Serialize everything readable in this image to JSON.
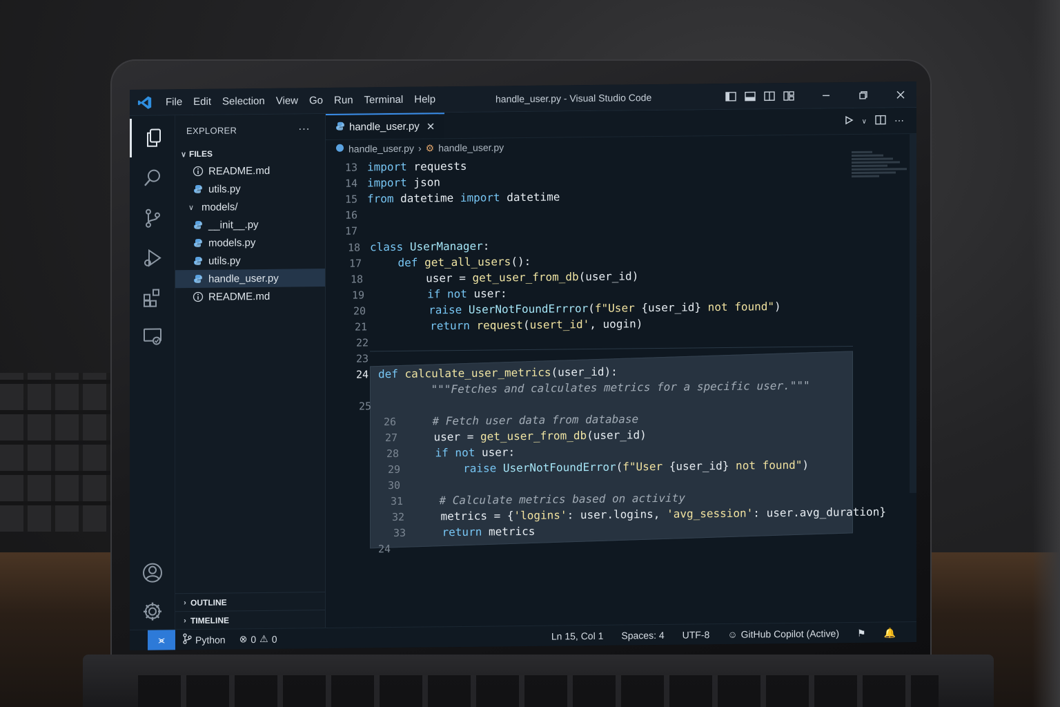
{
  "window": {
    "title": "handle_user.py - Visual Studio Code",
    "menu": [
      "File",
      "Edit",
      "Selection",
      "View",
      "Go",
      "Run",
      "Terminal",
      "Help"
    ]
  },
  "sidebar": {
    "header": "EXPLORER",
    "more": "···",
    "files_section": "FILES",
    "items": [
      {
        "label": "README.md",
        "icon": "info-icon",
        "indent": 1
      },
      {
        "label": "utils.py",
        "icon": "python-icon",
        "indent": 1
      },
      {
        "label": "models/",
        "icon": "folder-chevron",
        "indent": 0
      },
      {
        "label": "__init__.py",
        "icon": "python-icon",
        "indent": 1
      },
      {
        "label": "models.py",
        "icon": "python-icon",
        "indent": 1
      },
      {
        "label": "utils.py",
        "icon": "python-icon",
        "indent": 1
      },
      {
        "label": "handle_user.py",
        "icon": "python-icon",
        "indent": 1,
        "selected": true
      },
      {
        "label": "README.md",
        "icon": "info-icon",
        "indent": 1
      }
    ],
    "outline": "OUTLINE",
    "timeline": "TIMELINE"
  },
  "editor": {
    "tab": "handle_user.py",
    "breadcrumb": [
      "handle_user.py",
      "handle_user.py"
    ],
    "lines": [
      {
        "n": "13",
        "code": [
          [
            "kw",
            "import"
          ],
          [
            "var",
            " requests"
          ]
        ]
      },
      {
        "n": "14",
        "code": [
          [
            "kw",
            "import"
          ],
          [
            "var",
            " json"
          ]
        ]
      },
      {
        "n": "15",
        "code": [
          [
            "kw",
            "from"
          ],
          [
            "var",
            " datetime "
          ],
          [
            "kw",
            "import"
          ],
          [
            "var",
            " datetime"
          ]
        ]
      },
      {
        "n": "16",
        "code": []
      },
      {
        "n": "17",
        "code": []
      },
      {
        "n": "18",
        "code": [
          [
            "kw",
            "class"
          ],
          [
            "var",
            " "
          ],
          [
            "cls",
            "UserManager"
          ],
          [
            "var",
            ":"
          ]
        ]
      },
      {
        "n": "17",
        "code": [
          [
            "var",
            "    "
          ],
          [
            "kw",
            "def"
          ],
          [
            "var",
            " "
          ],
          [
            "fn",
            "get_all_users"
          ],
          [
            "var",
            "():"
          ]
        ]
      },
      {
        "n": "18",
        "code": [
          [
            "var",
            "        user = "
          ],
          [
            "fn",
            "get_user_from_db"
          ],
          [
            "var",
            "(user_id)"
          ]
        ]
      },
      {
        "n": "19",
        "code": [
          [
            "var",
            "        "
          ],
          [
            "kw",
            "if not"
          ],
          [
            "var",
            " user:"
          ]
        ]
      },
      {
        "n": "20",
        "code": [
          [
            "var",
            "        "
          ],
          [
            "kw",
            "raise"
          ],
          [
            "var",
            " "
          ],
          [
            "cls",
            "UserNotFoundErrror"
          ],
          [
            "var",
            "("
          ],
          [
            "str",
            "f\"User "
          ],
          [
            "var",
            "{user_id}"
          ],
          [
            "str",
            " not found\""
          ],
          [
            "var",
            ")"
          ]
        ]
      },
      {
        "n": "21",
        "code": [
          [
            "var",
            "        "
          ],
          [
            "kw",
            "return"
          ],
          [
            "var",
            " "
          ],
          [
            "fn",
            "request"
          ],
          [
            "var",
            "("
          ],
          [
            "str",
            "usert_id'"
          ],
          [
            "var",
            ", uogin)"
          ]
        ]
      },
      {
        "n": "22",
        "code": []
      },
      {
        "n": "23",
        "code": []
      },
      {
        "n": "24",
        "current": true,
        "code": [
          [
            "kw",
            "def"
          ],
          [
            "var",
            " "
          ],
          [
            "fn",
            "calculate_user_metrics"
          ],
          [
            "var",
            "(user_id):"
          ]
        ]
      },
      {
        "n": "",
        "code": [
          [
            "cm",
            "    \"\"\"Fetches and calculates metrics for a specific user.\"\"\""
          ]
        ]
      },
      {
        "n": "25",
        "code": []
      },
      {
        "n": "26",
        "code": [
          [
            "cm",
            "    # Fetch user data from database"
          ]
        ]
      },
      {
        "n": "27",
        "code": [
          [
            "var",
            "    user = "
          ],
          [
            "fn",
            "get_user_from_db"
          ],
          [
            "var",
            "(user_id)"
          ]
        ]
      },
      {
        "n": "28",
        "code": [
          [
            "var",
            "    "
          ],
          [
            "kw",
            "if not"
          ],
          [
            "var",
            " user:"
          ]
        ]
      },
      {
        "n": "29",
        "code": [
          [
            "var",
            "        "
          ],
          [
            "kw",
            "raise"
          ],
          [
            "var",
            " "
          ],
          [
            "cls",
            "UserNotFoundError"
          ],
          [
            "var",
            "("
          ],
          [
            "str",
            "f\"User "
          ],
          [
            "var",
            "{user_id}"
          ],
          [
            "str",
            " not found\""
          ],
          [
            "var",
            ")"
          ]
        ]
      },
      {
        "n": "30",
        "code": []
      },
      {
        "n": "31",
        "code": [
          [
            "cm",
            "    # Calculate metrics based on activity"
          ]
        ]
      },
      {
        "n": "32",
        "code": [
          [
            "var",
            "    metrics = {"
          ],
          [
            "str",
            "'logins'"
          ],
          [
            "var",
            ": user.logins, "
          ],
          [
            "str",
            "'avg_session'"
          ],
          [
            "var",
            ": user.avg_duration}"
          ]
        ]
      },
      {
        "n": "33",
        "code": [
          [
            "var",
            "    "
          ],
          [
            "kw",
            "return"
          ],
          [
            "var",
            " metrics"
          ]
        ]
      },
      {
        "n": "24",
        "code": []
      }
    ]
  },
  "statusbar": {
    "branch": "Python",
    "errors": "0",
    "warnings": "0",
    "position": "Ln 15, Col 1",
    "spaces": "Spaces: 4",
    "encoding": "UTF-8",
    "copilot": "GitHub Copilot (Active)"
  },
  "colors": {
    "accent": "#3b8eea",
    "keyword": "#78c7f5",
    "function": "#f1e6a4"
  }
}
